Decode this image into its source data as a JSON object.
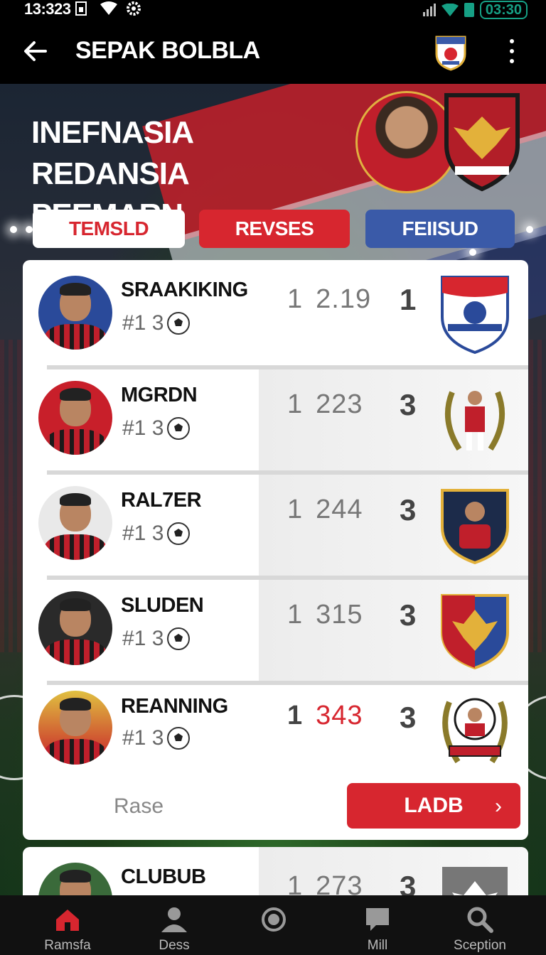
{
  "status": {
    "time": "13:323",
    "clock": "03:30"
  },
  "appbar": {
    "title": "SEPAK BOLBLA"
  },
  "hero": {
    "title": "INEFNASIA REDANSIA PEEMARN"
  },
  "tabs": [
    {
      "label": "TEMSLD"
    },
    {
      "label": "REVSES"
    },
    {
      "label": "FEIISUD"
    }
  ],
  "players": [
    {
      "name": "SRAAKIKING",
      "rank": "#1 3",
      "score_a": "1",
      "score_b": "2.19",
      "pos": "1"
    },
    {
      "name": "MGRDN",
      "rank": "#1 3",
      "score_a": "1",
      "score_b": "223",
      "pos": "3"
    },
    {
      "name": "RAL7ER",
      "rank": "#1 3",
      "score_a": "1",
      "score_b": "244",
      "pos": "3"
    },
    {
      "name": "SLUDEN",
      "rank": "#1 3",
      "score_a": "1",
      "score_b": "315",
      "pos": "3"
    },
    {
      "name": "REANNING",
      "rank": "#1 3",
      "score_a": "1",
      "score_b": "343",
      "pos": "3"
    },
    {
      "name": "CLUBUB",
      "rank": "",
      "score_a": "1",
      "score_b": "273",
      "pos": "3"
    }
  ],
  "more": {
    "label": "Rase",
    "button": "LADB",
    "chevron": "›"
  },
  "nav": [
    {
      "label": "Ramsfa",
      "icon": "home-icon"
    },
    {
      "label": "Dess",
      "icon": "person-icon"
    },
    {
      "label": "",
      "icon": "circle-icon"
    },
    {
      "label": "Mill",
      "icon": "chat-icon"
    },
    {
      "label": "Sception",
      "icon": "search-icon"
    }
  ],
  "colors": {
    "accent": "#d7262f",
    "blue": "#3a5aa8",
    "background": "#000000"
  }
}
